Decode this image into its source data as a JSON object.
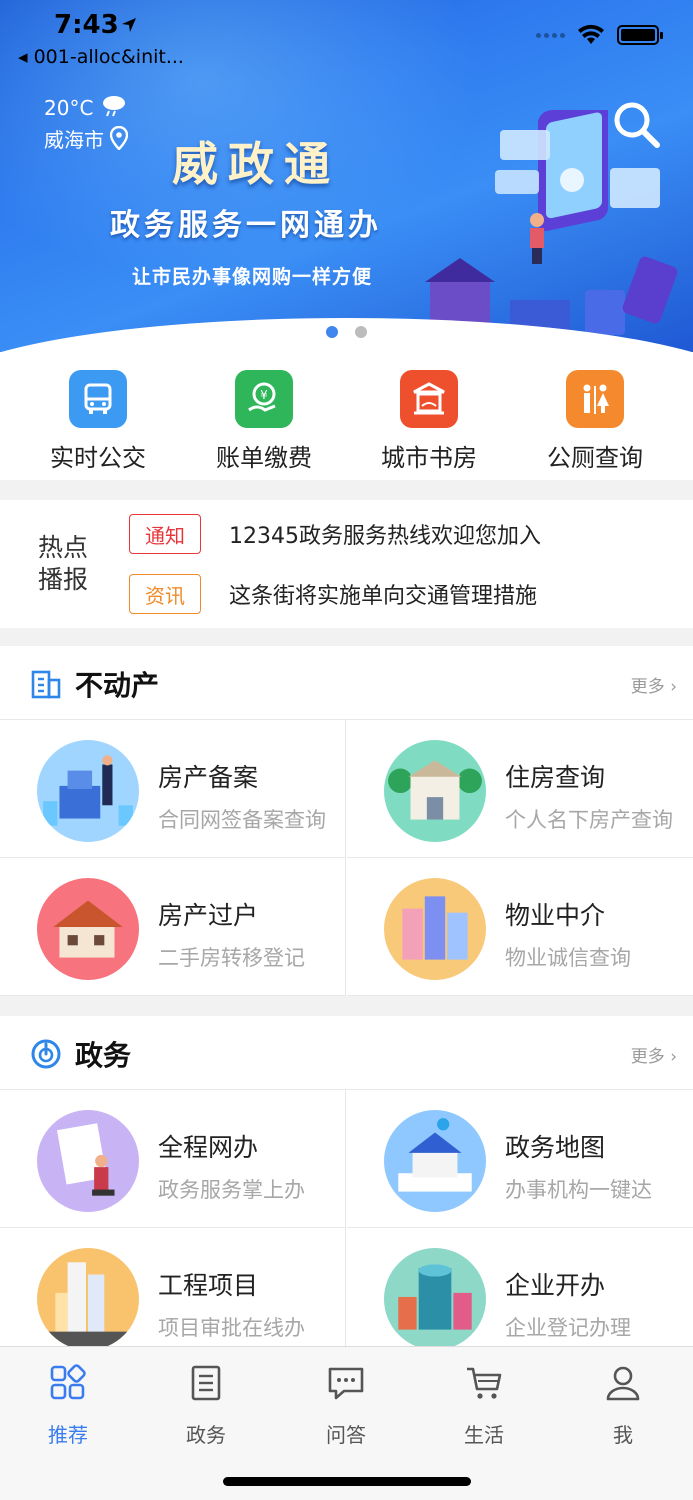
{
  "status_bar": {
    "time": "7:43",
    "back_app": "001-alloc&init..."
  },
  "weather": {
    "temperature": "20°C",
    "city": "威海市"
  },
  "banner": {
    "title": "威政通",
    "subtitle": "政务服务一网通办",
    "tagline": "让市民办事像网购一样方便",
    "pages": 2,
    "active_page": 1
  },
  "quick_services": [
    {
      "label": "实时公交",
      "icon": "bus-icon",
      "color": "#3d9af2"
    },
    {
      "label": "账单缴费",
      "icon": "money-hand-icon",
      "color": "#2fb55a"
    },
    {
      "label": "城市书房",
      "icon": "library-icon",
      "color": "#ee4f2c"
    },
    {
      "label": "公厕查询",
      "icon": "restroom-icon",
      "color": "#f48a2d"
    }
  ],
  "hot_news": {
    "title": "热点播报",
    "items": [
      {
        "tag": "通知",
        "tag_color": "#e9363a",
        "text": "12345政务服务热线欢迎您加入"
      },
      {
        "tag": "资讯",
        "tag_color": "#f08a2a",
        "text": "这条街将实施单向交通管理措施"
      }
    ]
  },
  "sections": [
    {
      "title": "不动产",
      "icon": "building-icon",
      "more": "更多",
      "items": [
        {
          "title": "房产备案",
          "subtitle": "合同网签备案查询"
        },
        {
          "title": "住房查询",
          "subtitle": "个人名下房产查询"
        },
        {
          "title": "房产过户",
          "subtitle": "二手房转移登记"
        },
        {
          "title": "物业中介",
          "subtitle": "物业诚信查询"
        }
      ]
    },
    {
      "title": "政务",
      "icon": "power-icon",
      "more": "更多",
      "items": [
        {
          "title": "全程网办",
          "subtitle": "政务服务掌上办"
        },
        {
          "title": "政务地图",
          "subtitle": "办事机构一键达"
        },
        {
          "title": "工程项目",
          "subtitle": "项目审批在线办"
        },
        {
          "title": "企业开办",
          "subtitle": "企业登记办理"
        }
      ]
    }
  ],
  "tabbar": [
    {
      "label": "推荐",
      "icon": "recommend-icon",
      "active": true
    },
    {
      "label": "政务",
      "icon": "list-icon",
      "active": false
    },
    {
      "label": "问答",
      "icon": "chat-icon",
      "active": false
    },
    {
      "label": "生活",
      "icon": "cart-icon",
      "active": false
    },
    {
      "label": "我",
      "icon": "user-icon",
      "active": false
    }
  ],
  "colors": {
    "accent": "#3a7cf0",
    "banner": "#2f7cf0"
  }
}
